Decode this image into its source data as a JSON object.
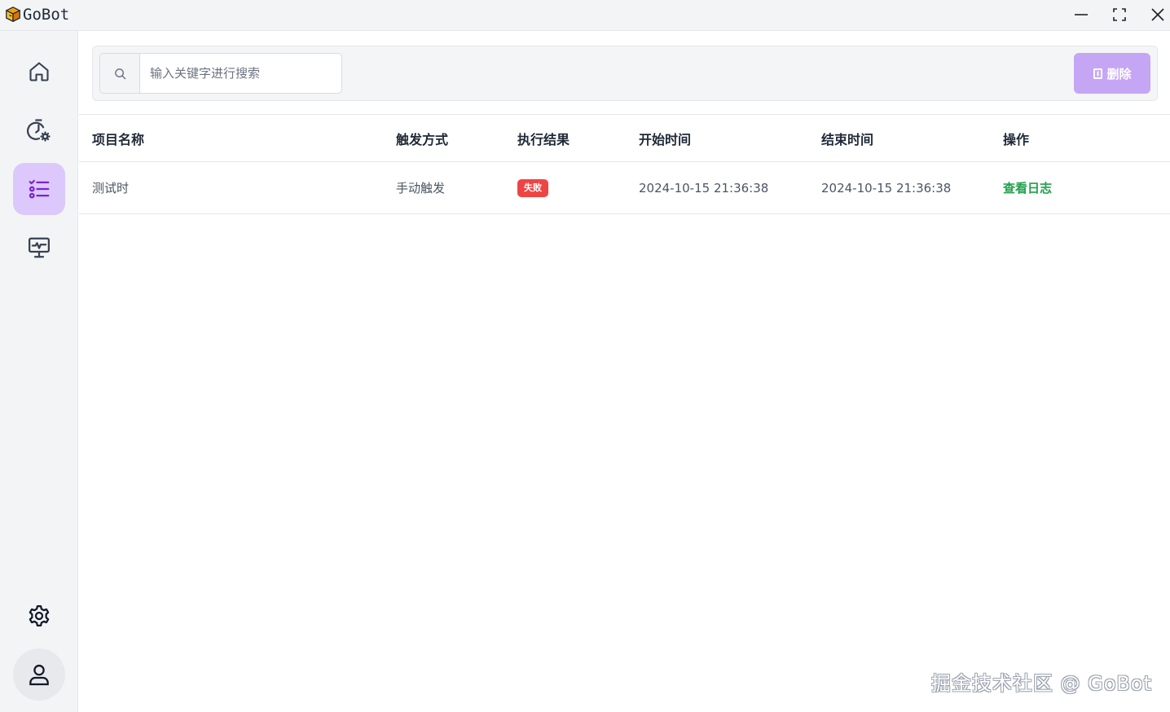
{
  "app": {
    "title": "GoBot"
  },
  "window_controls": {
    "minimize": "minimize-icon",
    "maximize": "maximize-icon",
    "close": "close-icon"
  },
  "sidebar": {
    "items": [
      {
        "icon": "home-icon",
        "active": false
      },
      {
        "icon": "timer-settings-icon",
        "active": false
      },
      {
        "icon": "task-list-icon",
        "active": true
      },
      {
        "icon": "monitor-icon",
        "active": false
      }
    ],
    "bottom": [
      {
        "icon": "gear-icon"
      },
      {
        "icon": "user-icon"
      }
    ]
  },
  "toolbar": {
    "search_placeholder": "输入关键字进行搜索",
    "search_value": "",
    "delete_label": "删除"
  },
  "table": {
    "columns": [
      "项目名称",
      "触发方式",
      "执行结果",
      "开始时间",
      "结束时间",
      "操作"
    ],
    "rows": [
      {
        "name": "测试时",
        "trigger": "手动触发",
        "result": "失败",
        "start": "2024-10-15 21:36:38",
        "end": "2024-10-15 21:36:38",
        "action": "查看日志"
      }
    ]
  },
  "watermark": "掘金技术社区 @ GoBot",
  "colors": {
    "accent": "#c5a6f5",
    "active_nav": "#dcc8fb",
    "fail": "#ef4444",
    "link": "#22a04b"
  }
}
